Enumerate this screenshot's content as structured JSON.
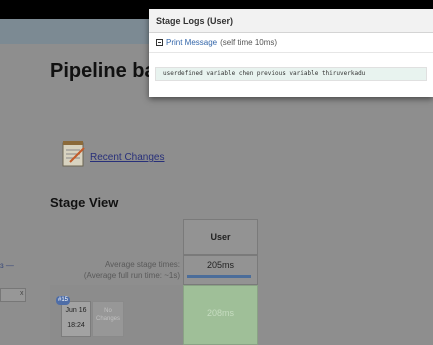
{
  "page": {
    "title": "Pipeline batch",
    "recent_changes": "Recent Changes",
    "stage_view_title": "Stage View"
  },
  "stage_view": {
    "column_header": "User",
    "avg_label_line1": "Average stage times:",
    "avg_label_line2": "(Average full run time: ~1s)",
    "avg_value": "205ms",
    "build": {
      "number": "#15",
      "date": "Jun 16",
      "time": "18:24",
      "changes": "No Changes",
      "stage_time": "208ms"
    }
  },
  "left_clip": {
    "fragment": "ɜ —",
    "close": "x"
  },
  "logs_popup": {
    "title": "Stage Logs (User)",
    "step_name": "Print Message",
    "step_meta": "(self time 10ms)",
    "output": "userdefined variable chen previous variable thiruverkadu"
  },
  "colors": {
    "success_cell": "#9fbf98",
    "avg_bar": "#4b6d9a",
    "link": "#3366aa"
  }
}
